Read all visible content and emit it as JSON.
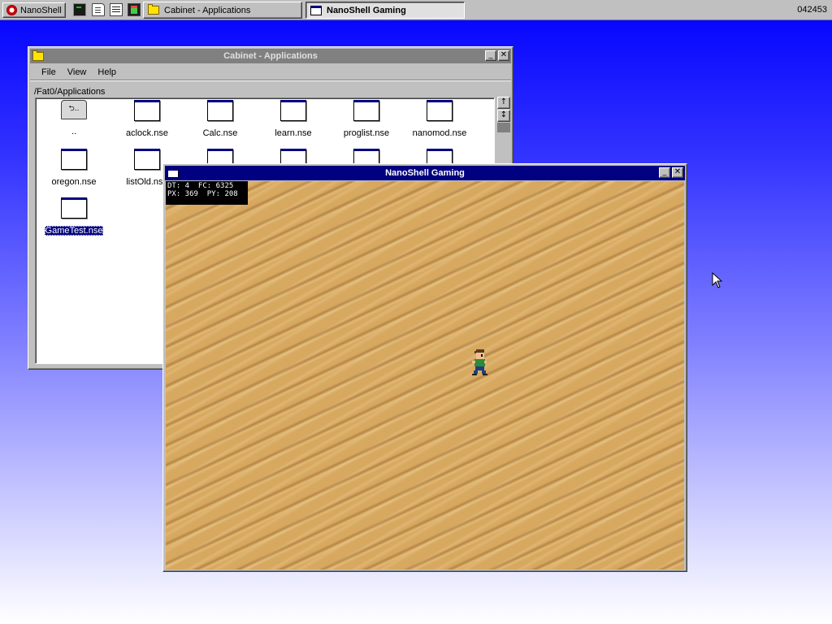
{
  "taskbar": {
    "start_label": "NanoShell",
    "tasks": [
      {
        "label": "Cabinet - Applications",
        "icon": "folder-icon"
      },
      {
        "label": "NanoShell Gaming",
        "icon": "window-icon"
      }
    ],
    "clock": "042453"
  },
  "cabinet": {
    "title": "Cabinet - Applications",
    "menu": [
      "File",
      "View",
      "Help"
    ],
    "path": "/Fat0/Applications",
    "files": [
      {
        "label": "..",
        "icon": "parent-folder-icon"
      },
      {
        "label": "aclock.nse",
        "icon": "app-icon"
      },
      {
        "label": "Calc.nse",
        "icon": "app-icon"
      },
      {
        "label": "learn.nse",
        "icon": "app-icon"
      },
      {
        "label": "proglist.nse",
        "icon": "app-icon"
      },
      {
        "label": "nanomod.nse",
        "icon": "app-icon"
      },
      {
        "label": "oregon.nse",
        "icon": "app-icon"
      },
      {
        "label": "listOld.nse",
        "icon": "app-icon"
      },
      {
        "label": "",
        "icon": "app-icon"
      },
      {
        "label": "",
        "icon": "app-icon"
      },
      {
        "label": "",
        "icon": "app-icon"
      },
      {
        "label": "",
        "icon": "app-icon"
      },
      {
        "label": "GameTest.nse",
        "icon": "app-icon",
        "selected": true
      }
    ]
  },
  "gaming": {
    "title": "NanoShell Gaming",
    "debug_line1": "DT: 4  FC: 6325",
    "debug_line2": "PX: 369  PY: 208"
  },
  "colors": {
    "active_title": "#000080",
    "inactive_title": "#808080",
    "window_face": "#c0c0c0",
    "sand": "#d7a85f",
    "desktop_top": "#0000ff"
  }
}
